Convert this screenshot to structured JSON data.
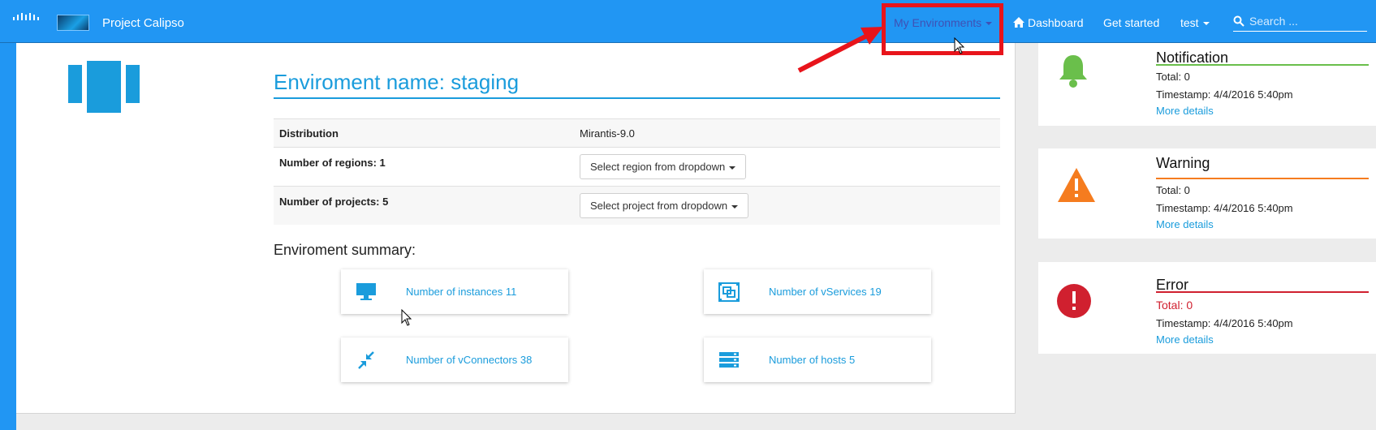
{
  "header": {
    "logo_text": "CISCO",
    "app_title": "Project Calipso",
    "nav": {
      "my_environments": "My Environments",
      "dashboard": "Dashboard",
      "get_started": "Get started",
      "user": "test"
    },
    "search_placeholder": "Search ..."
  },
  "environment": {
    "title": "Enviroment name: staging",
    "rows": [
      {
        "label": "Distribution",
        "value": "Mirantis-9.0"
      },
      {
        "label": "Number of regions: 1",
        "dropdown": "Select region from dropdown"
      },
      {
        "label": "Number of projects: 5",
        "dropdown": "Select project from dropdown"
      }
    ]
  },
  "summary": {
    "title": "Enviroment summary:",
    "cards": [
      {
        "label": "Number of instances 11",
        "icon": "monitor-icon"
      },
      {
        "label": "Number of vServices 19",
        "icon": "vservices-icon"
      },
      {
        "label": "Number of vConnectors 38",
        "icon": "compress-arrows-icon"
      },
      {
        "label": "Number of hosts 5",
        "icon": "server-stack-icon"
      }
    ]
  },
  "notifications": [
    {
      "title": "Notification",
      "total": "Total: 0",
      "timestamp": "Timestamp: 4/4/2016 5:40pm",
      "link": "More details",
      "color": "#6abf4b",
      "icon": "bell-icon"
    },
    {
      "title": "Warning",
      "total": "Total: 0",
      "timestamp": "Timestamp: 4/4/2016 5:40pm",
      "link": "More details",
      "color": "#f57c1f",
      "icon": "warning-triangle-icon"
    },
    {
      "title": "Error",
      "total": "Total: 0",
      "timestamp": "Timestamp: 4/4/2016 5:40pm",
      "link": "More details",
      "color": "#d0202f",
      "icon": "error-circle-icon"
    }
  ],
  "colors": {
    "topbar": "#2196f3",
    "accent": "#1a9cdc",
    "highlight": "#e8141b"
  }
}
